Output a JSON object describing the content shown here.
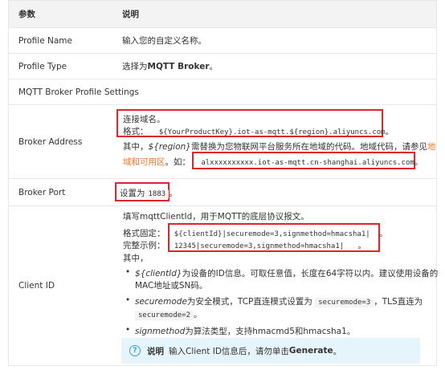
{
  "header": {
    "col1": "参数",
    "col2": "说明"
  },
  "rows": {
    "profile_name": {
      "label": "Profile Name",
      "desc": "输入您的自定义名称。"
    },
    "profile_type": {
      "label": "Profile Type",
      "desc_prefix": "选择为",
      "desc_bold": "MQTT Broker",
      "desc_suffix": "。"
    },
    "section": {
      "label": "MQTT Broker Profile Settings"
    },
    "broker_address": {
      "label": "Broker Address",
      "line1": "连接域名。",
      "format_label": "格式：",
      "format_code": "${YourProductKey}.iot-as-mqtt.${region}.aliyuncs.com",
      "period": "。",
      "explain_prefix": "其中，",
      "explain_region": "${region}",
      "explain_mid": "需替换为您物联网平台服务所在地域的代码。地域代码，请参见",
      "explain_link1": "地",
      "explain_link2": "域和可用区",
      "example_label": "。如：",
      "example_code": "alxxxxxxxxxx.iot-as-mqtt.cn-shanghai.aliyuncs.com",
      "example_end": "。"
    },
    "broker_port": {
      "label": "Broker Port",
      "prefix": "设置为",
      "value": "1883",
      "suffix": "。"
    },
    "client_id": {
      "label": "Client ID",
      "line1": "填写mqttClientId，用于MQTT的底层协议报文。",
      "fixed_label": "格式固定：",
      "fixed_code": "${clientId}|securemode=3,signmethod=hmacsha1|",
      "fixed_end": "。",
      "example_label": "完整示例：",
      "example_code": "12345|securemode=3,signmethod=hmacsha1|",
      "example_end": "。",
      "where": "其中，",
      "b1_italic": "${clientId}",
      "b1_text": "为设备的ID信息。可取任意值，长度在64字符以内。建议使用设备的",
      "b1_line2": "MAC地址或SN码。",
      "b2_italic": "securemode",
      "b2_text": "为安全模式，TCP直连模式设置为",
      "b2_code1": "securemode=3",
      "b2_text2": "，TLS直连为",
      "b2_code2": "securemode=2",
      "b2_end": "。",
      "b3_italic": "signmethod",
      "b3_text": "为算法类型，支持hmacmd5和hmacsha1。",
      "note_label": "说明",
      "note_text": "输入Client ID信息后，请勿单击",
      "note_bold": "Generate",
      "note_end": "。"
    }
  },
  "colors": {
    "highlight_box": "#e1242c",
    "link": "#ee7a30",
    "note_bg": "#e6f4fb",
    "note_icon": "#3fa0d6"
  }
}
